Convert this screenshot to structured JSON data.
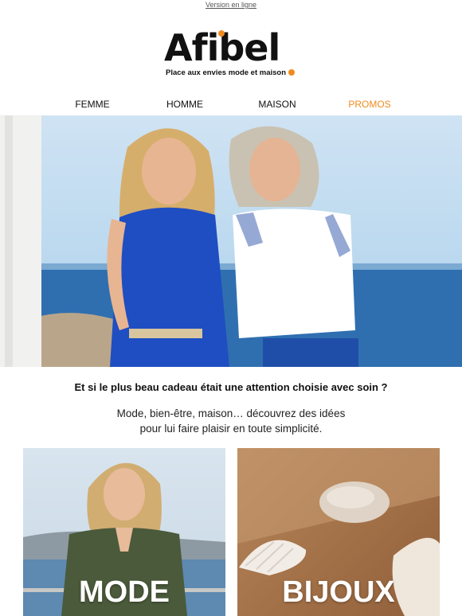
{
  "header": {
    "view_online": "Version en ligne",
    "logo_text": "Afibel",
    "tagline": "Place aux envies mode et maison"
  },
  "nav": {
    "items": [
      {
        "label": "FEMME"
      },
      {
        "label": "HOMME"
      },
      {
        "label": "MAISON"
      },
      {
        "label": "PROMOS"
      }
    ]
  },
  "content": {
    "headline": "Et si le plus beau cadeau était une attention choisie avec soin ?",
    "sub_line1": "Mode, bien-être, maison… découvrez des idées",
    "sub_line2": "pour lui faire plaisir en toute simplicité."
  },
  "cards": [
    {
      "label": "MODE"
    },
    {
      "label": "BIJOUX"
    }
  ],
  "colors": {
    "accent": "#f08a1c",
    "text": "#111111",
    "background": "#ffffff"
  }
}
